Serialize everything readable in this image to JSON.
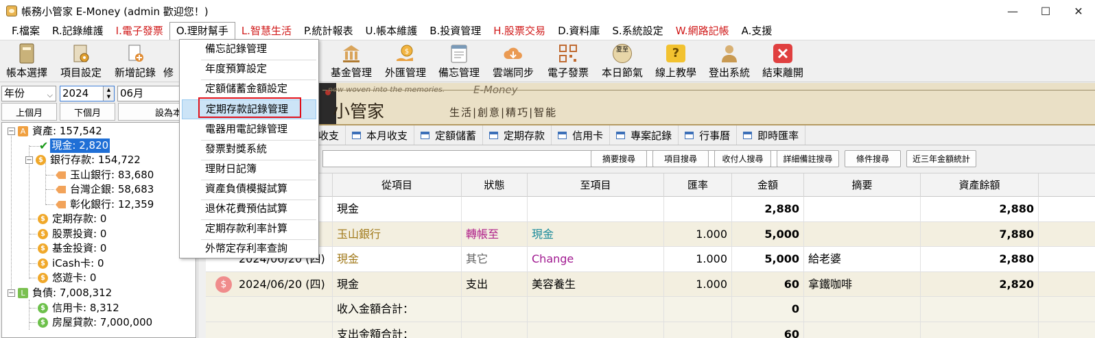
{
  "window": {
    "title": "帳務小管家 E-Money (admin 歡迎您！)",
    "min": "—",
    "max": "☐",
    "close": "✕"
  },
  "menu": [
    {
      "label": "F.檔案",
      "red": false
    },
    {
      "label": "R.記錄維護",
      "red": false
    },
    {
      "label": "I.電子發票",
      "red": true
    },
    {
      "label": "O.理財幫手",
      "red": false,
      "open": true
    },
    {
      "label": "L.智慧生活",
      "red": true
    },
    {
      "label": "P.統計報表",
      "red": false
    },
    {
      "label": "U.帳本維護",
      "red": false
    },
    {
      "label": "B.投資管理",
      "red": false
    },
    {
      "label": "H.股票交易",
      "red": true
    },
    {
      "label": "D.資料庫",
      "red": false
    },
    {
      "label": "S.系統設定",
      "red": false
    },
    {
      "label": "W.網路記帳",
      "red": true
    },
    {
      "label": "A.支援",
      "red": false
    }
  ],
  "toolbar": {
    "book_select": "帳本選擇",
    "item_settings": "項目設定",
    "new_record": "新增記錄",
    "modify": "修",
    "fund": "基金管理",
    "forex": "外匯管理",
    "memo": "備忘管理",
    "cloud": "雲端同步",
    "einvoice": "電子發票",
    "solar_term": "本日節氣",
    "tutorial": "線上教學",
    "logout": "登出系統",
    "exit": "結束離開",
    "solar_term_glyph": "夏至",
    "tutorial_glyph": "?"
  },
  "filters": {
    "period": "年份",
    "year": "2024",
    "month": "06月",
    "prev_month": "上個月",
    "next_month": "下個月",
    "this_month": "設為本月"
  },
  "tree": {
    "assets": "資產: 157,542",
    "cash": "現金: 2,820",
    "bank": "銀行存款: 154,722",
    "esun": "玉山銀行: 83,680",
    "tbb": "台灣企銀: 58,683",
    "chb": "彰化銀行: 12,359",
    "fixed": "定期存款: 0",
    "stock": "股票投資: 0",
    "fund": "基金投資: 0",
    "icash": "iCash卡: 0",
    "easycard": "悠遊卡: 0",
    "liab": "負債: 7,008,312",
    "credit": "信用卡: 8,312",
    "mortgage": "房屋貸款: 7,000,000",
    "assets_badge": "A",
    "liab_badge": "L",
    "coin_glyph": "$",
    "minus": "−",
    "check_glyph": "✔"
  },
  "banner": {
    "small": "now woven into the memories.",
    "em": "E-Money",
    "big": "小管家",
    "slogan": "生活|創意|精巧|智能"
  },
  "tabs": [
    "收支",
    "本月收支",
    "定額儲蓄",
    "定期存款",
    "信用卡",
    "專案記錄",
    "行事曆",
    "即時匯率"
  ],
  "search_buttons": [
    "摘要搜尋",
    "項目搜尋",
    "收付人搜尋",
    "詳細備註搜尋",
    "條件搜尋",
    "近三年金額統計"
  ],
  "grid": {
    "columns": [
      "從項目",
      "狀態",
      "至項目",
      "匯率",
      "金額",
      "摘要",
      "資產餘額"
    ],
    "rows": [
      {
        "date": "",
        "from": "現金",
        "status": "",
        "to": "",
        "rate": "",
        "amount": "2,880",
        "memo": "",
        "balance": "2,880",
        "alt": false
      },
      {
        "date": "",
        "from": "玉山銀行",
        "status": "轉帳至",
        "to": "現金",
        "rate": "1.000",
        "amount": "5,000",
        "memo": "",
        "balance": "7,880",
        "alt": true
      },
      {
        "date": "2024/06/20 (四)",
        "from": "現金",
        "status": "其它",
        "to": "Change",
        "rate": "1.000",
        "amount": "5,000",
        "memo": "給老婆",
        "balance": "2,880",
        "alt": false
      },
      {
        "date": "2024/06/20 (四)",
        "from": "現金",
        "status": "支出",
        "to": "美容養生",
        "rate": "1.000",
        "amount": "60",
        "memo": "拿鐵咖啡",
        "balance": "2,820",
        "alt": true
      }
    ],
    "income_total_label": "收入金額合計：",
    "income_total": "0",
    "expense_total_label": "支出金額合計：",
    "expense_total": "60",
    "row_icon_glyph": "$"
  },
  "dropdown": [
    "備忘記錄管理",
    "年度預算設定",
    "定額儲蓄金額設定",
    "定期存款記錄管理",
    "電器用電記錄管理",
    "發票對獎系統",
    "理財日記簿",
    "資產負債模擬試算",
    "退休花費預估試算",
    "定期存款利率計算",
    "外幣定存利率查詢"
  ],
  "colors": {
    "menu_red": "#d01818",
    "selection": "#1f6fd6",
    "highlight": "#cce4f7",
    "annotation_box": "#e0101a",
    "status_transfer": "#b0208a",
    "to_cash": "#1a8a9a",
    "income_color": "#a07818",
    "other_status": "#606060",
    "change_color": "#a01890"
  }
}
